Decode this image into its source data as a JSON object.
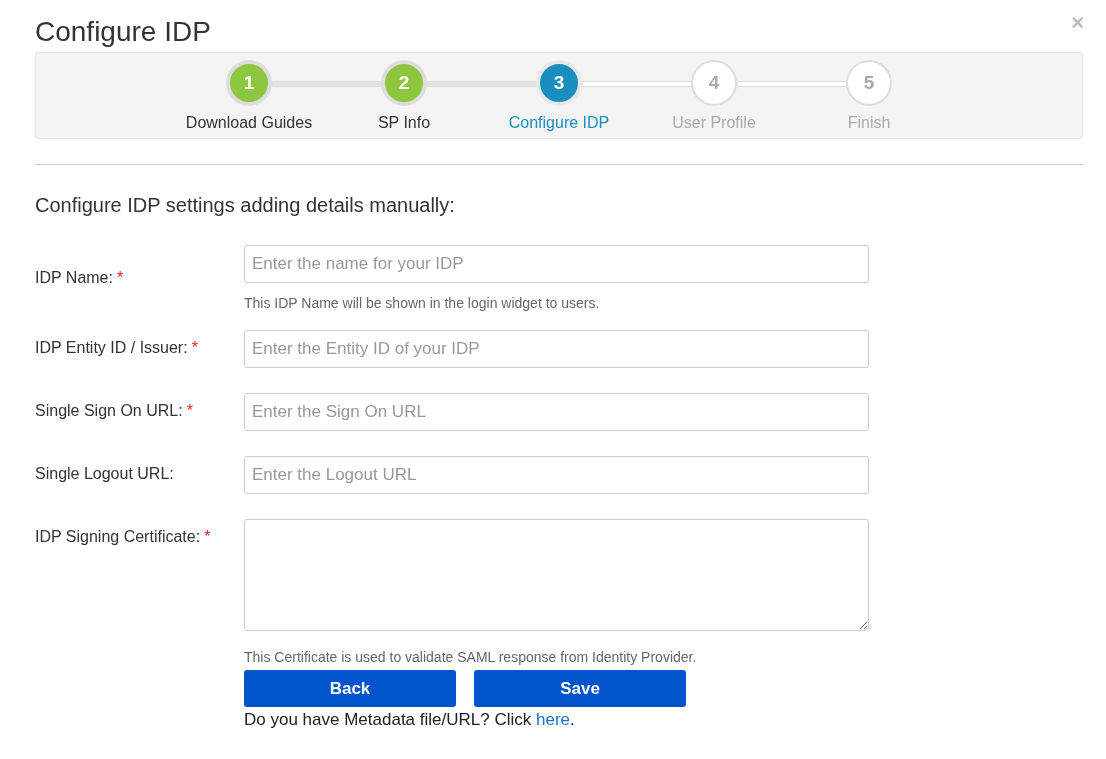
{
  "dialog": {
    "title": "Configure IDP",
    "close": "×"
  },
  "steps": [
    {
      "number": "1",
      "label": "Download Guides",
      "completed": true,
      "selected": false
    },
    {
      "number": "2",
      "label": "SP Info",
      "completed": true,
      "selected": false
    },
    {
      "number": "3",
      "label": "Configure IDP",
      "completed": false,
      "selected": true
    },
    {
      "number": "4",
      "label": "User Profile",
      "completed": false,
      "selected": false
    },
    {
      "number": "5",
      "label": "Finish",
      "completed": false,
      "selected": false
    }
  ],
  "form": {
    "heading": "Configure IDP settings adding details manually:",
    "fields": [
      {
        "kind": "input",
        "label": "IDP Name:",
        "required": true,
        "placeholder": "Enter the name for your IDP",
        "help": "This IDP Name will be shown in the login widget to users."
      },
      {
        "kind": "input",
        "label": "IDP Entity ID / Issuer:",
        "required": true,
        "placeholder": "Enter the Entity ID of your IDP"
      },
      {
        "kind": "input",
        "label": "Single Sign On URL:",
        "required": true,
        "placeholder": "Enter the Sign On URL"
      },
      {
        "kind": "input",
        "label": "Single Logout URL:",
        "required": false,
        "placeholder": "Enter the Logout URL"
      },
      {
        "kind": "textarea",
        "label": "IDP Signing Certificate:",
        "required": true,
        "help": "This Certificate is used to validate SAML response from Identity Provider."
      }
    ],
    "required_mark": "*",
    "buttons": [
      "Back",
      "Save"
    ],
    "metadata": {
      "prefix": "Do you have Metadata file/URL? Click ",
      "link": "here",
      "suffix": "."
    }
  }
}
